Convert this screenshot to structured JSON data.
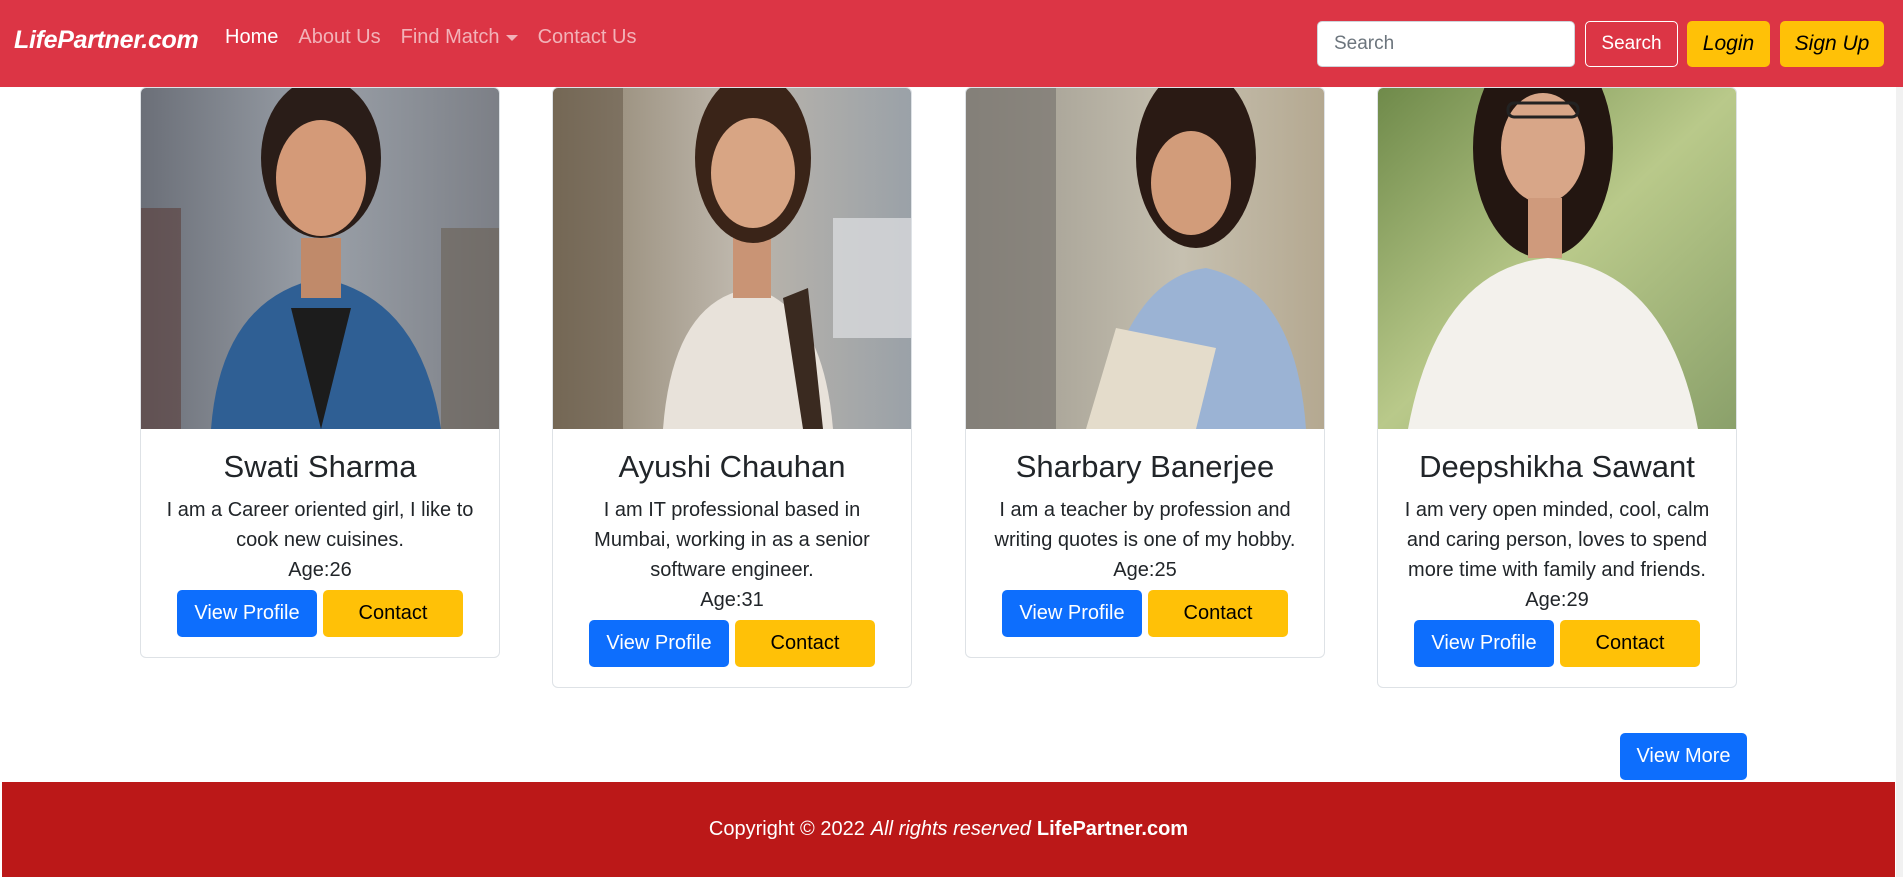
{
  "nav": {
    "brand": "LifePartner.com",
    "links": [
      {
        "label": "Home"
      },
      {
        "label": "About Us"
      },
      {
        "label": "Find Match"
      },
      {
        "label": "Contact Us"
      }
    ],
    "search_placeholder": "Search",
    "search_button": "Search",
    "login_button": "Login",
    "signup_button": "Sign Up"
  },
  "profiles": [
    {
      "name": "Swati Sharma",
      "description": "I am a Career oriented girl, I like to cook new cuisines.",
      "age": "Age:26",
      "view_label": "View Profile",
      "contact_label": "Contact"
    },
    {
      "name": "Ayushi Chauhan",
      "description": "I am IT professional based in Mumbai, working in as a senior software engineer.",
      "age": "Age:31",
      "view_label": "View Profile",
      "contact_label": "Contact"
    },
    {
      "name": "Sharbary Banerjee",
      "description": "I am a teacher by profession and writing quotes is one of my hobby.",
      "age": "Age:25",
      "view_label": "View Profile",
      "contact_label": "Contact"
    },
    {
      "name": "Deepshikha Sawant",
      "description": "I am very open minded, cool, calm and caring person, loves to spend more time with family and friends.",
      "age": "Age:29",
      "view_label": "View Profile",
      "contact_label": "Contact"
    }
  ],
  "view_more": "View More",
  "footer": {
    "prefix": "Copyright © 2022",
    "rights": "All rights reserved",
    "brand": "LifePartner.com"
  }
}
